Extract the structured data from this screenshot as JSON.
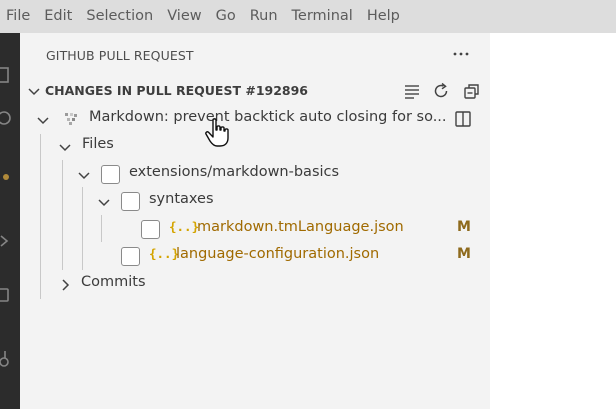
{
  "menu": [
    "File",
    "Edit",
    "Selection",
    "View",
    "Go",
    "Run",
    "Terminal",
    "Help"
  ],
  "panel": {
    "title": "GITHUB PULL REQUEST",
    "more_icon": "ellipsis-icon"
  },
  "section": {
    "title": "CHANGES IN PULL REQUEST #192896",
    "actions": [
      "list-view-icon",
      "refresh-icon",
      "collapse-all-icon"
    ]
  },
  "pr": {
    "title": "Markdown: prevent backtick auto closing for so...",
    "action_icon": "open-split-view-icon"
  },
  "tree": {
    "files_label": "Files",
    "folder": "extensions/markdown-basics",
    "subfolder": "syntaxes",
    "files": [
      {
        "icon": "{..}",
        "name": "markdown.tmLanguage.json",
        "status": "M"
      },
      {
        "icon": "{..}",
        "name": "language-configuration.json",
        "status": "M"
      }
    ],
    "commits_label": "Commits"
  },
  "colors": {
    "menubar": "#dddddd",
    "sidebar": "#f3f3f3",
    "activitybar": "#2c2c2c",
    "json_icon": "#d4a400",
    "modified": "#8e6a1d"
  }
}
